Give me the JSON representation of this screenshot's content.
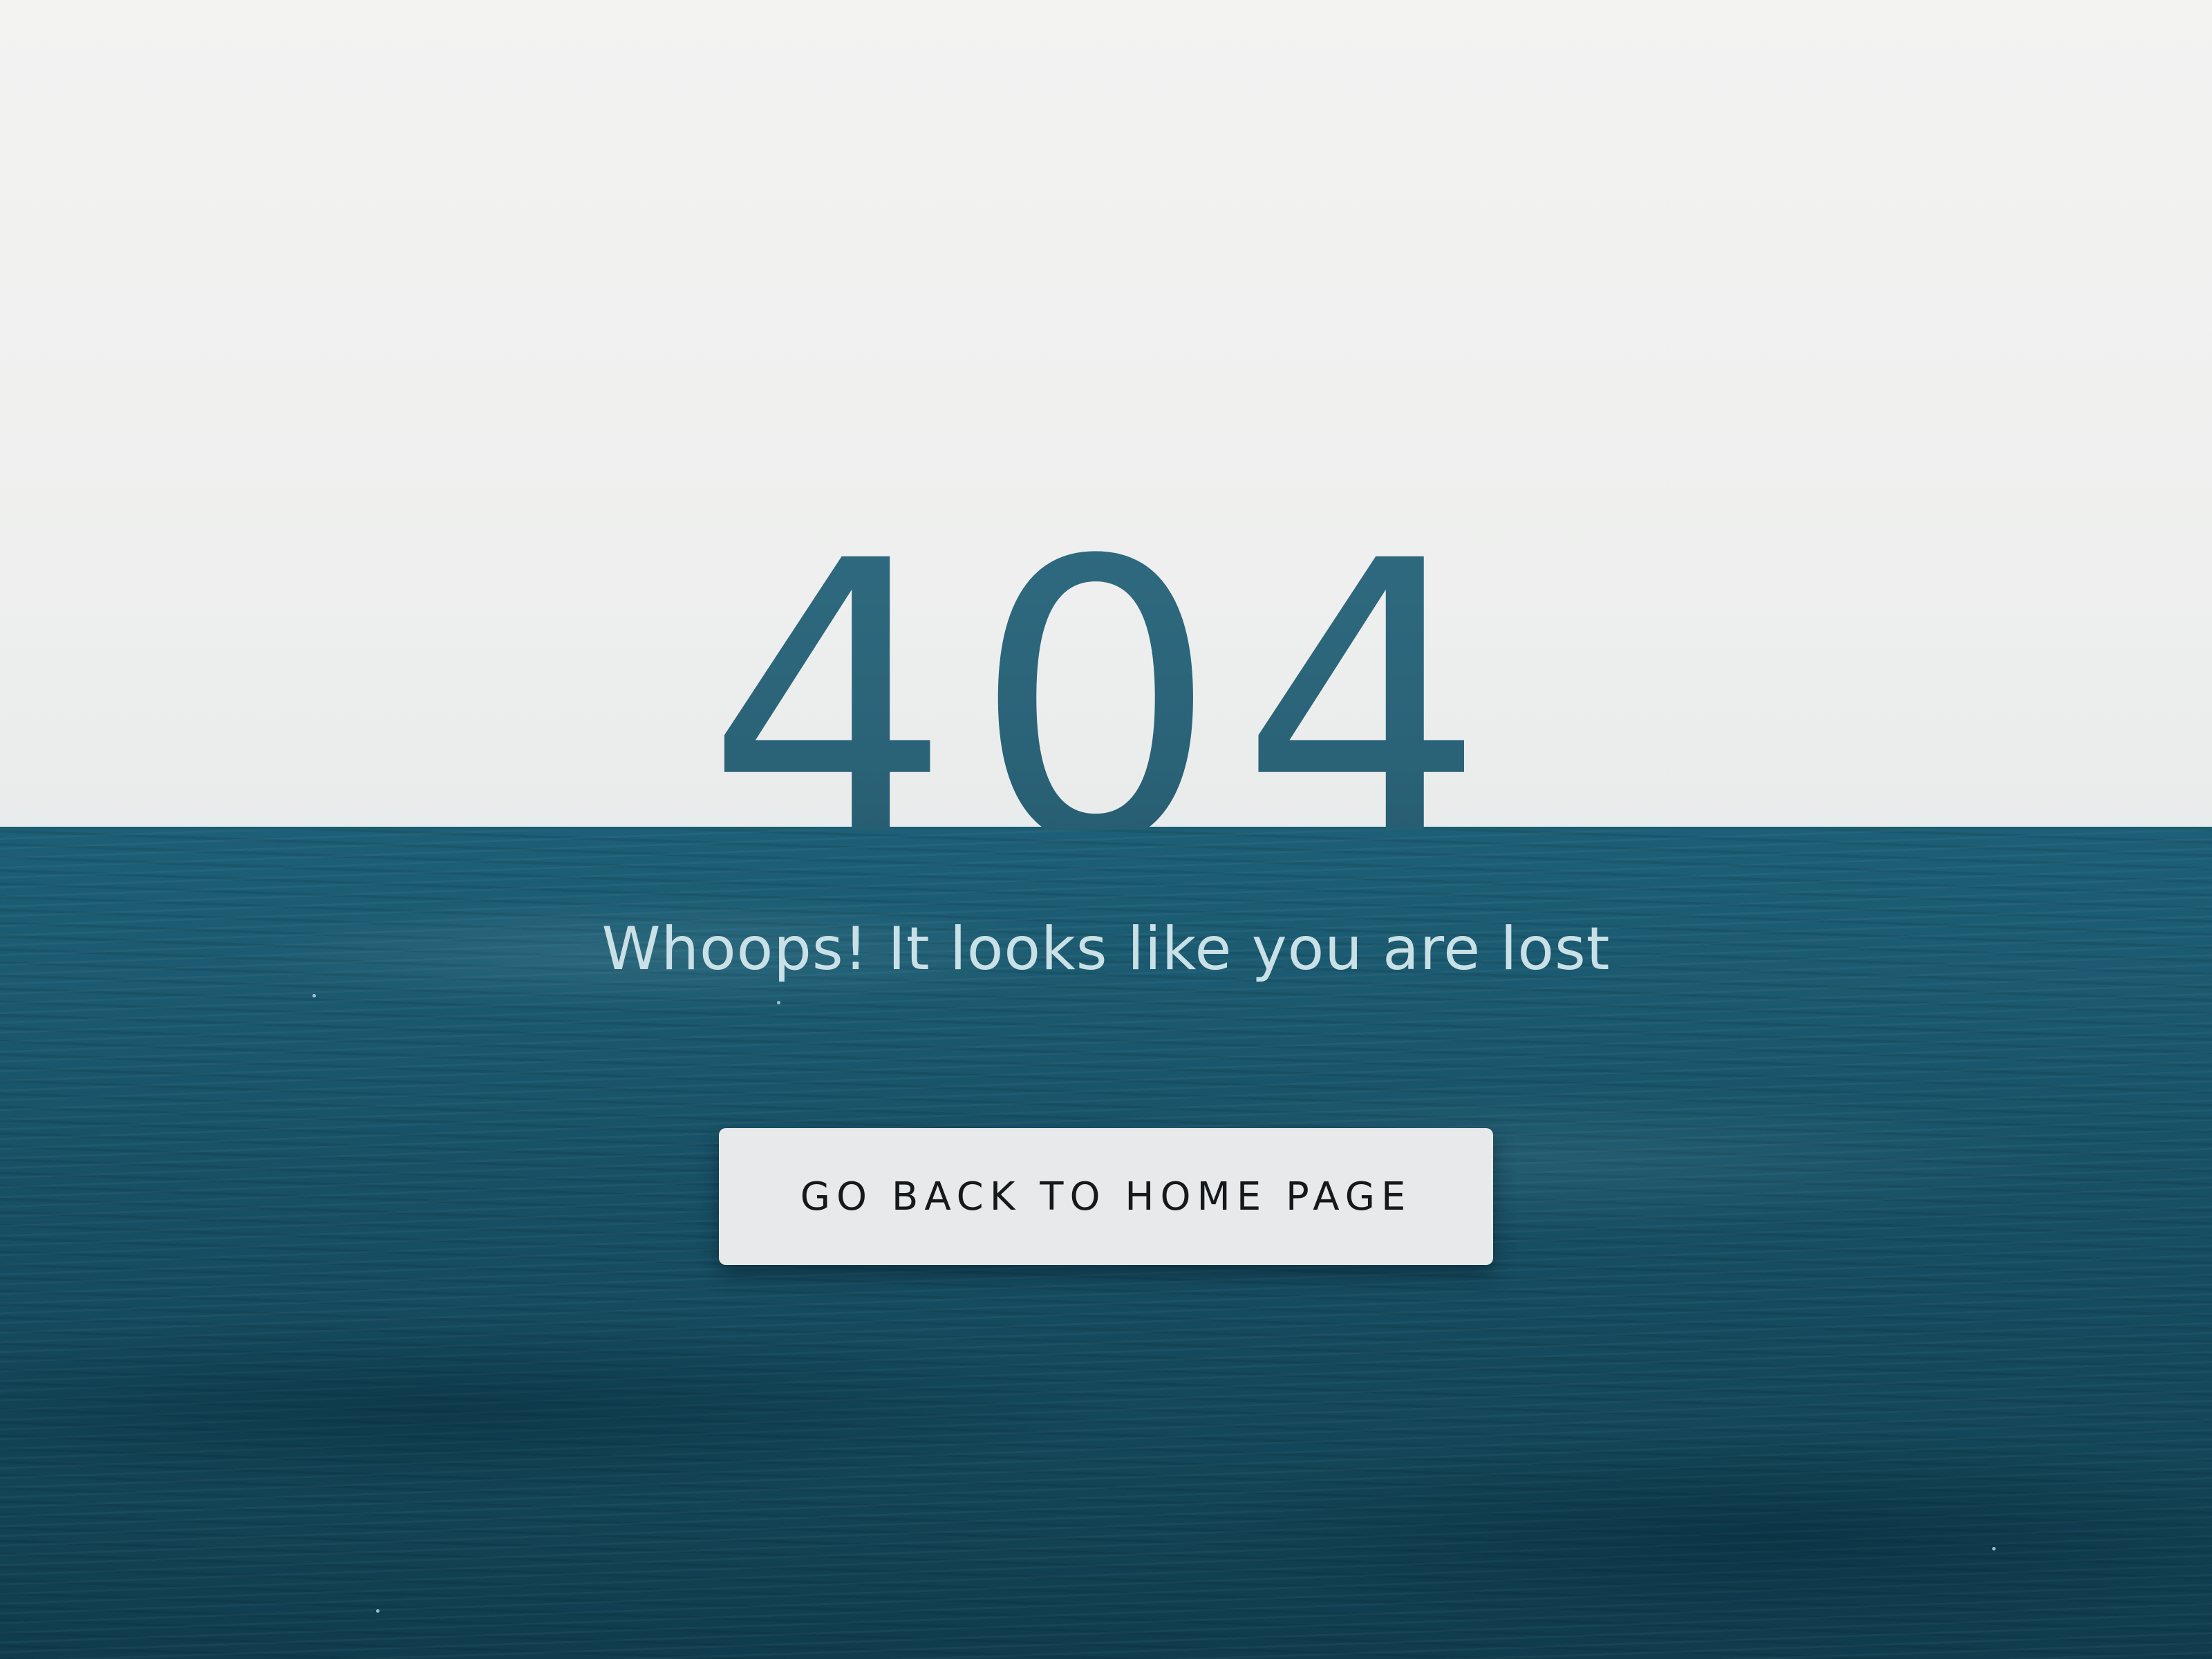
{
  "error": {
    "code": "404",
    "message": "Whoops! It looks like you are lost"
  },
  "actions": {
    "home_label": "GO BACK TO HOME PAGE"
  },
  "colors": {
    "sky": "#eff0ef",
    "sea": "#1b5a70",
    "code_text": "#2c6479",
    "message_text": "#c9e1e6",
    "button_bg": "#e7e9eb",
    "button_text": "#15191c"
  }
}
